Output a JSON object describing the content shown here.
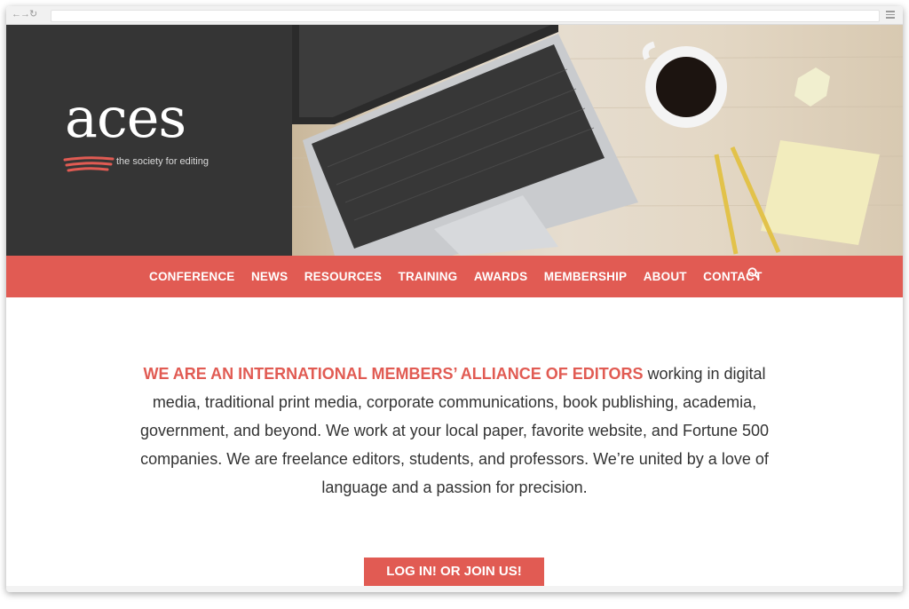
{
  "brand": {
    "logo_word": "aces",
    "tagline": "the society for editing",
    "accent": "#e15b53",
    "dark_panel": "#353535"
  },
  "browser": {
    "nav_icons": [
      "back-arrow-icon",
      "forward-arrow-icon",
      "reload-icon"
    ],
    "menu_icon": "hamburger-menu-icon"
  },
  "nav": {
    "items": [
      "CONFERENCE",
      "NEWS",
      "RESOURCES",
      "TRAINING",
      "AWARDS",
      "MEMBERSHIP",
      "ABOUT",
      "CONTACT"
    ],
    "search_icon": "search-icon"
  },
  "intro": {
    "lead": "WE ARE AN INTERNATIONAL MEMBERS’ ALLIANCE OF EDITORS",
    "body": " working in digital media, traditional print media, corporate communications, book publishing, academia, government, and beyond. We work at your local paper, favorite website, and Fortune 500 companies. We are freelance editors, students, and professors. We’re united by a love of language and a passion for precision."
  },
  "cta": {
    "label": "LOG IN! OR JOIN US!"
  }
}
